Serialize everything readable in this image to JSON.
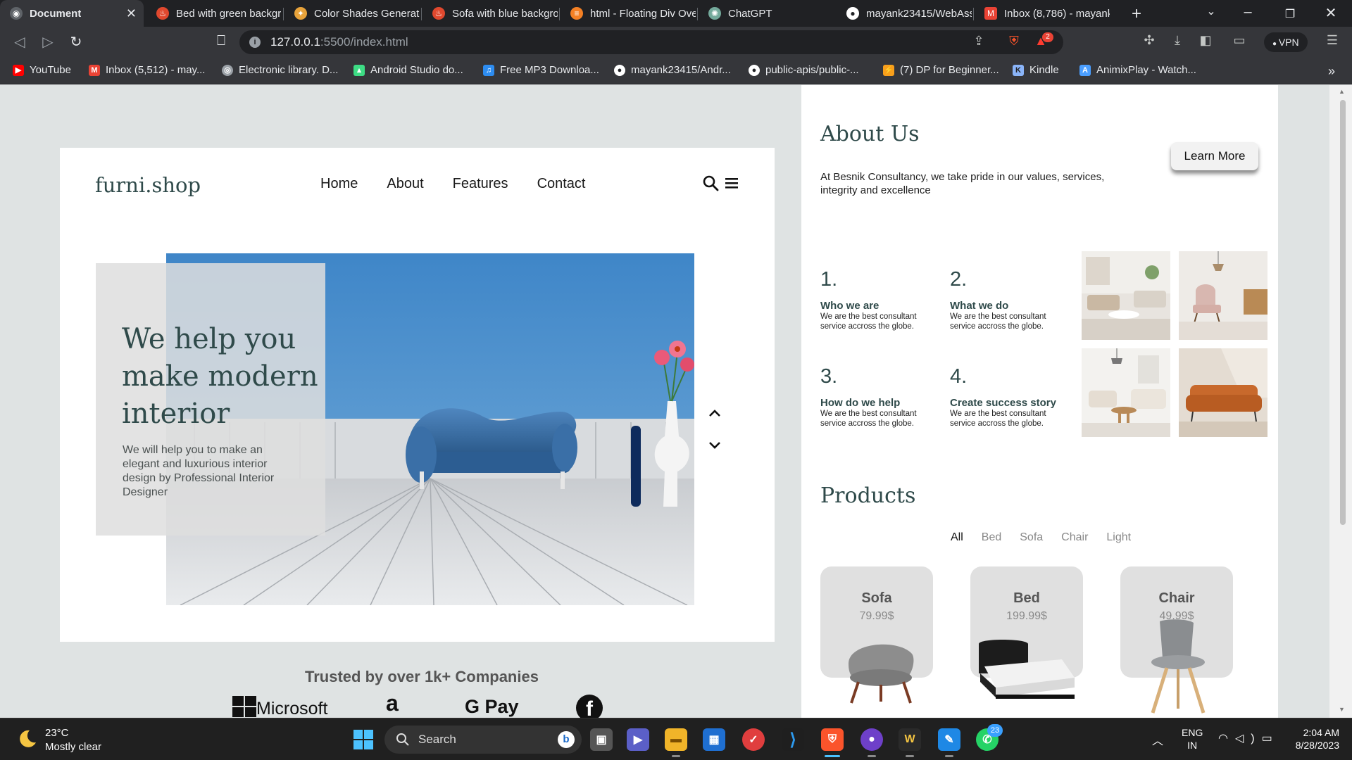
{
  "browser": {
    "tabs": [
      {
        "title": "Document",
        "active": true,
        "icon": "globe-icon",
        "color": "#9aa0a6"
      },
      {
        "title": "Bed with green backgr",
        "icon": "fire-icon",
        "color": "#e0482e"
      },
      {
        "title": "Color Shades Generato",
        "icon": "tools-icon",
        "color": "#e8a33b"
      },
      {
        "title": "Sofa with blue backgro",
        "icon": "fire-icon",
        "color": "#e0482e"
      },
      {
        "title": "html - Floating Div Ove",
        "icon": "stackoverflow-icon",
        "color": "#f48024"
      },
      {
        "title": "ChatGPT",
        "icon": "chatgpt-icon",
        "color": "#74aa9c"
      },
      {
        "title": "mayank23415/WebAss",
        "icon": "github-icon",
        "color": "#ffffff"
      },
      {
        "title": "Inbox (8,786) - mayank",
        "icon": "gmail-icon",
        "color": "#ea4335"
      }
    ],
    "new_tab": "+",
    "url_host": "127.0.0.1",
    "url_rest": ":5500/index.html",
    "vpn_label": "VPN",
    "brave_badge": "2",
    "bookmarks": [
      {
        "label": "YouTube",
        "icon": "youtube-icon",
        "color": "#ff0000"
      },
      {
        "label": "Inbox (5,512) - may...",
        "icon": "gmail-icon",
        "color": "#ea4335"
      },
      {
        "label": "Electronic library. D...",
        "icon": "library-icon",
        "color": "#9aa0a6"
      },
      {
        "label": "Android Studio do...",
        "icon": "android-icon",
        "color": "#3ddc84"
      },
      {
        "label": "Free MP3 Downloa...",
        "icon": "music-icon",
        "color": "#2d8cf0"
      },
      {
        "label": "mayank23415/Andr...",
        "icon": "github-icon",
        "color": "#ffffff"
      },
      {
        "label": "public-apis/public-...",
        "icon": "github-icon",
        "color": "#ffffff"
      },
      {
        "label": "(7) DP for Beginner...",
        "icon": "leetcode-icon",
        "color": "#f89f1b"
      },
      {
        "label": "Kindle",
        "icon": "kindle-icon",
        "color": "#8ab4f8"
      },
      {
        "label": "AnimixPlay - Watch...",
        "icon": "animix-icon",
        "color": "#4a9eff"
      }
    ]
  },
  "hero": {
    "logo": "furni.shop",
    "nav": [
      "Home",
      "About",
      "Features",
      "Contact"
    ],
    "headline_lines": [
      "We help you",
      "make modern",
      "interior"
    ],
    "subtext": "We will help you to make an elegant and luxurious interior design by Professional Interior Designer",
    "trusted": "Trusted by over 1k+ Companies",
    "brands": [
      "Microsoft",
      "a",
      "G Pay",
      "f"
    ]
  },
  "about": {
    "title": "About Us",
    "button": "Learn More",
    "text": "At Besnik Consultancy, we take pride in our values, services, integrity and excellence",
    "steps": [
      {
        "num": "1.",
        "title": "Who we are",
        "desc": "We are the best consultant service accross the globe."
      },
      {
        "num": "2.",
        "title": "What we do",
        "desc": "We are the best consultant service accross the globe."
      },
      {
        "num": "3.",
        "title": "How do we help",
        "desc": "We are the best consultant service accross the globe."
      },
      {
        "num": "4.",
        "title": "Create success story",
        "desc": "We are the best consultant service accross the globe."
      }
    ]
  },
  "products": {
    "title": "Products",
    "filters": [
      "All",
      "Bed",
      "Sofa",
      "Chair",
      "Light"
    ],
    "active_filter": "All",
    "items": [
      {
        "name": "Sofa",
        "price": "79.99$"
      },
      {
        "name": "Bed",
        "price": "199.99$"
      },
      {
        "name": "Chair",
        "price": "49.99$"
      }
    ]
  },
  "taskbar": {
    "temp": "23°C",
    "weather": "Mostly clear",
    "search": "Search",
    "whatsapp_badge": "23",
    "lang_1": "ENG",
    "lang_2": "IN",
    "time": "2:04 AM",
    "date": "8/28/2023"
  },
  "colors": {
    "accent": "#2f4a4a",
    "page_bg": "#dfe3e3",
    "photo_blue": "#4b8cc4"
  }
}
